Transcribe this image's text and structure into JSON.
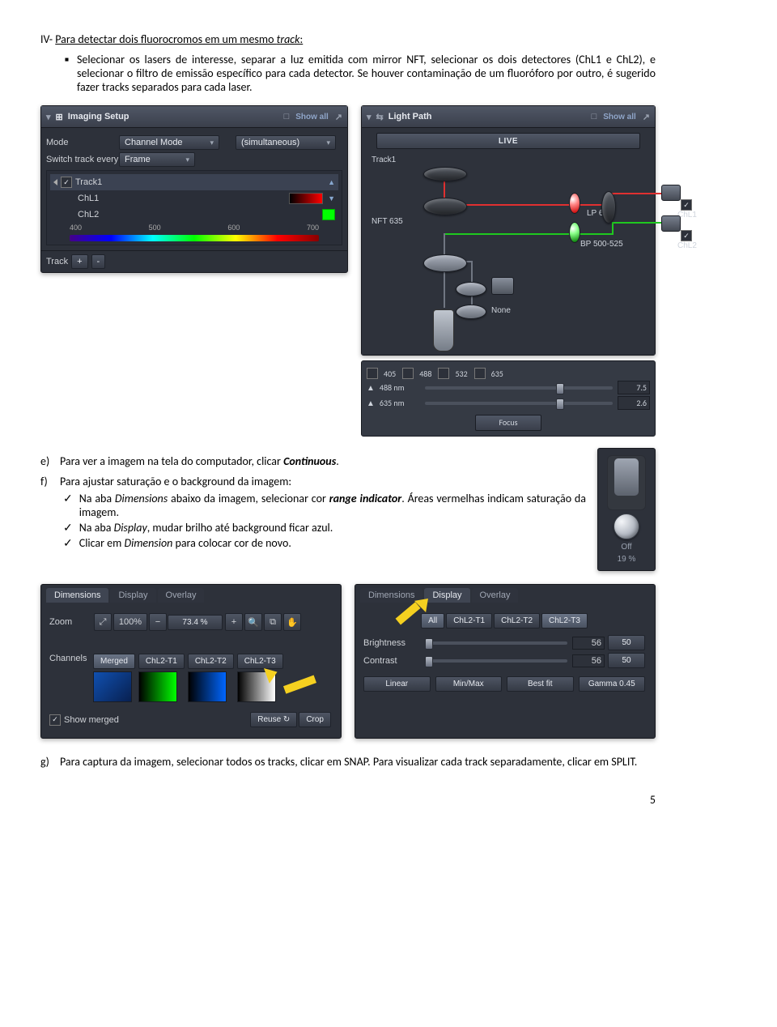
{
  "section": {
    "prefix": "IV-",
    "title_plain": "Para detectar dois fluorocromos em um mesmo ",
    "title_ital": "track",
    "title_suffix": ":"
  },
  "bullet1": {
    "text": "Selecionar os lasers de interesse, separar a luz emitida com mirror NFT, selecionar os dois detectores (ChL1 e ChL2), e selecionar o filtro de emissão específico para cada detector. Se houver contaminação de um fluoróforo por outro, é sugerido fazer tracks separados para cada laser."
  },
  "imaging": {
    "title": "Imaging Setup",
    "showall": "Show all",
    "mode_label": "Mode",
    "mode_value": "Channel Mode",
    "simul": "(simultaneous)",
    "switch_label": "Switch track every",
    "switch_value": "Frame",
    "track1": "Track1",
    "chl1": "ChL1",
    "chl2": "ChL2",
    "ticks": [
      "400",
      "500",
      "600",
      "700"
    ],
    "track_label": "Track",
    "plus": "+",
    "minus": "-"
  },
  "lightpath": {
    "title": "Light Path",
    "showall": "Show all",
    "live": "LIVE",
    "track1": "Track1",
    "nft": "NFT 635",
    "lp650": "LP 650",
    "bp": "BP 500-525",
    "chl1": "ChL1",
    "chl2": "ChL2",
    "none": "None",
    "wavelengths": [
      "405",
      "488",
      "532",
      "635"
    ],
    "lasers": [
      {
        "name": "488 nm",
        "value": "7.5"
      },
      {
        "name": "635 nm",
        "value": "2.6"
      }
    ],
    "focus": "Focus",
    "off": "Off",
    "pct": "19 %"
  },
  "item_e": {
    "letter": "e)",
    "text_a": "Para ver a imagem na tela do computador, clicar ",
    "text_b": "Continuous",
    "text_c": "."
  },
  "item_f": {
    "letter": "f)",
    "text": "Para ajustar saturação e o background da imagem:",
    "checks": [
      {
        "a": "Na aba ",
        "b": "Dimensions",
        "c": " abaixo da imagem, selecionar cor ",
        "d": "range indicator",
        "e": ". Áreas vermelhas indicam saturação da imagem."
      },
      {
        "a": "Na aba ",
        "b": "Display",
        "c": ", mudar brilho até background ficar azul.",
        "d": "",
        "e": ""
      },
      {
        "a": "Clicar em ",
        "b": "Dimension",
        "c": " para colocar cor de novo.",
        "d": "",
        "e": ""
      }
    ]
  },
  "dim_panel": {
    "tabs": [
      "Dimensions",
      "Display",
      "Overlay"
    ],
    "zoom_label": "Zoom",
    "zoom_100": "100%",
    "zoom_val": "73.4 %",
    "channels_label": "Channels",
    "merged": "Merged",
    "ch_buttons": [
      "ChL2-T1",
      "ChL2-T2",
      "ChL2-T3"
    ],
    "show_merged": "Show merged",
    "reuse": "Reuse",
    "crop": "Crop"
  },
  "disp_panel": {
    "tabs": [
      "Dimensions",
      "Display",
      "Overlay"
    ],
    "all": "All",
    "ch_buttons": [
      "ChL2-T1",
      "ChL2-T2",
      "ChL2-T3"
    ],
    "brightness_label": "Brightness",
    "brightness_val": "56",
    "brightness_def": "50",
    "contrast_label": "Contrast",
    "contrast_val": "56",
    "contrast_def": "50",
    "buttons": [
      "Linear",
      "Min/Max",
      "Best fit",
      "Gamma 0.45"
    ]
  },
  "item_g": {
    "letter": "g)",
    "text": "Para captura da imagem, selecionar todos os tracks, clicar em SNAP. Para visualizar cada track separadamente, clicar em SPLIT."
  },
  "page": "5"
}
